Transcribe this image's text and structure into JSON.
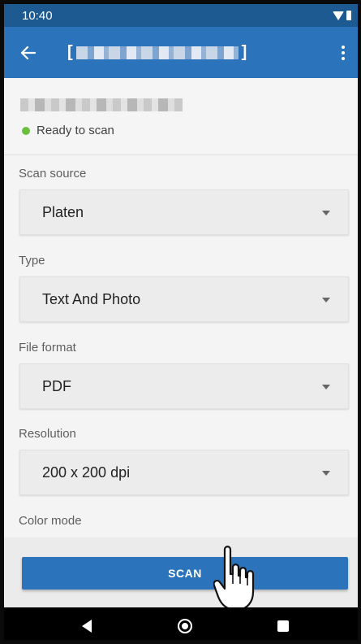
{
  "status_bar": {
    "time": "10:40"
  },
  "app_bar": {
    "back_icon": "arrow-left-icon",
    "overflow_icon": "more-vert-icon",
    "title_open": "[",
    "title_close": "]"
  },
  "device": {
    "status": "Ready to scan",
    "status_color": "#6abf3f"
  },
  "fields": [
    {
      "label": "Scan source",
      "value": "Platen"
    },
    {
      "label": "Type",
      "value": "Text And Photo"
    },
    {
      "label": "File format",
      "value": "PDF"
    },
    {
      "label": "Resolution",
      "value": "200 x 200 dpi"
    },
    {
      "label": "Color mode"
    }
  ],
  "scan_button": {
    "label": "SCAN"
  },
  "colors": {
    "primary": "#2b74bb",
    "status_bar": "#1c5a91"
  }
}
